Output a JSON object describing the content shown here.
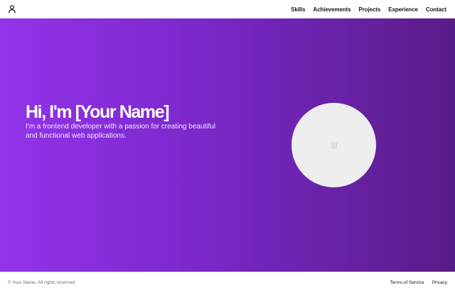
{
  "header": {
    "logo_icon": "person-icon",
    "nav": [
      {
        "label": "Skills"
      },
      {
        "label": "Achievements"
      },
      {
        "label": "Projects"
      },
      {
        "label": "Experience"
      },
      {
        "label": "Contact"
      }
    ]
  },
  "hero": {
    "title": "Hi, I'm [Your Name]",
    "subtitle": "I'm a frontend developer with a passion for creating beautiful and functional web applications.",
    "gradient_start": "#9333ea",
    "gradient_end": "#581c87",
    "avatar_icon": "broken-image-icon"
  },
  "footer": {
    "copyright": "© Your Name. All rights reserved.",
    "links": [
      {
        "label": "Terms of Service"
      },
      {
        "label": "Privacy"
      }
    ]
  }
}
